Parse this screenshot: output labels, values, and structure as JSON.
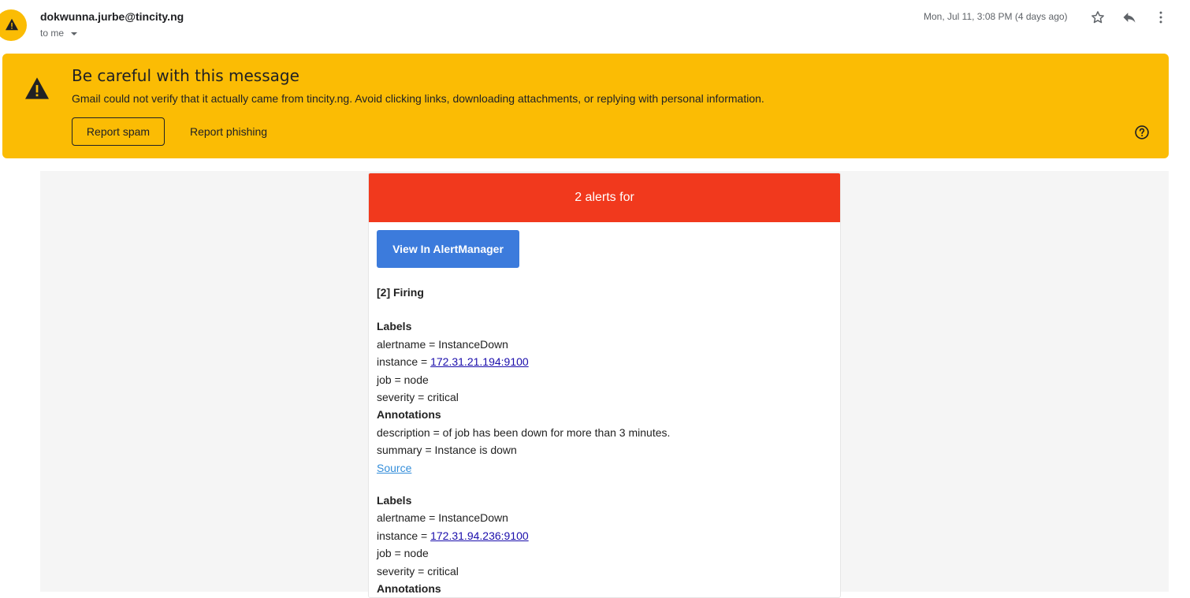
{
  "header": {
    "sender": "dokwunna.jurbe@tincity.ng",
    "recipient": "to me",
    "timestamp": "Mon, Jul 11, 3:08 PM (4 days ago)"
  },
  "warning": {
    "title": "Be careful with this message",
    "text": "Gmail could not verify that it actually came from tincity.ng. Avoid clicking links, downloading attachments, or replying with personal information.",
    "report_spam": "Report spam",
    "report_phishing": "Report phishing"
  },
  "email": {
    "banner": "2 alerts for",
    "view_button": "View In AlertManager",
    "firing": "[2] Firing",
    "alerts": [
      {
        "labels_heading": "Labels",
        "alertname": "alertname = InstanceDown",
        "instance_prefix": "instance = ",
        "instance_link": "172.31.21.194:9100",
        "job": "job = node",
        "severity": "severity = critical",
        "annotations_heading": "Annotations",
        "description": "description = of job has been down for more than 3 minutes.",
        "summary": "summary = Instance is down",
        "source": "Source"
      },
      {
        "labels_heading": "Labels",
        "alertname": "alertname = InstanceDown",
        "instance_prefix": "instance = ",
        "instance_link": "172.31.94.236:9100",
        "job": "job = node",
        "severity": "severity = critical",
        "annotations_heading": "Annotations"
      }
    ]
  },
  "colors": {
    "warning_bg": "#fbbc04",
    "alert_banner": "#f1391d",
    "button_blue": "#3c7bdc",
    "link": "#1a0dab"
  },
  "icons": [
    "warning-icon",
    "chevron-down-icon",
    "star-icon",
    "reply-icon",
    "more-vert-icon",
    "help-icon"
  ]
}
